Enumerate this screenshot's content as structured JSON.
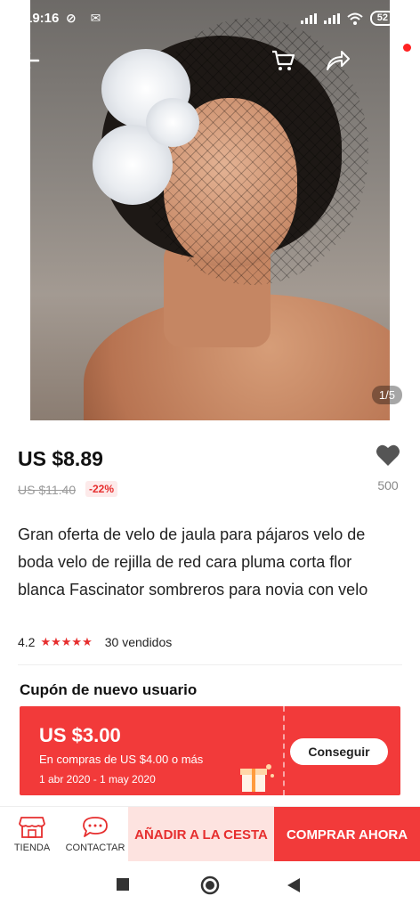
{
  "status_bar": {
    "time": "19:16",
    "left_icons": "⊘ ✉",
    "battery": "52"
  },
  "image_gallery": {
    "counter": "1/5"
  },
  "product": {
    "price": "US $8.89",
    "original_price": "US $11.40",
    "discount": "-22%",
    "wishlist_count": "500",
    "title": "Gran oferta de velo de jaula para pájaros velo de boda velo de rejilla de red cara pluma corta flor blanca Fascinator sombreros para novia con velo",
    "rating": "4.2",
    "rating_stars": "★★★★★",
    "sold": "30 vendidos"
  },
  "coupon": {
    "heading": "Cupón de nuevo usuario",
    "amount": "US $3.00",
    "condition": "En compras de US $4.00 o más",
    "dates": "1 abr 2020 - 1 may 2020",
    "button": "Conseguir"
  },
  "bottom_bar": {
    "store": "TIENDA",
    "contact": "CONTACTAR",
    "add_to_cart": "AÑADIR A LA CESTA",
    "buy_now": "COMPRAR AHORA"
  },
  "colors": {
    "accent": "#f23a3a",
    "accent_light": "#fde3e0"
  },
  "icons": [
    "back-arrow-icon",
    "cart-icon",
    "share-icon",
    "more-icon",
    "heart-icon",
    "store-icon",
    "chat-icon",
    "gift-icon"
  ]
}
